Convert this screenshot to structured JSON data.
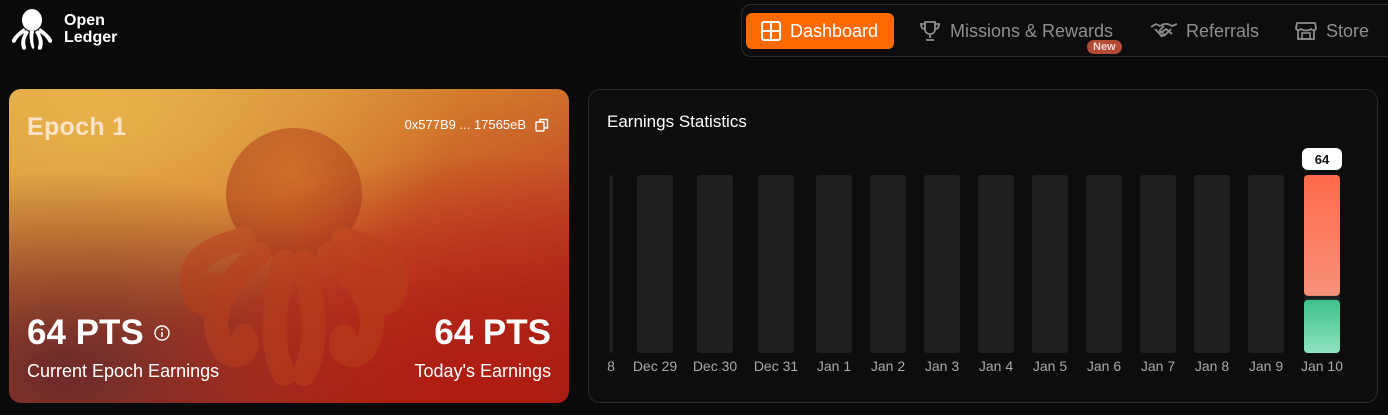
{
  "brand": {
    "line1": "Open",
    "line2": "Ledger"
  },
  "nav": {
    "items": [
      {
        "label": "Dashboard",
        "icon": "grid-icon",
        "active": true
      },
      {
        "label": "Missions & Rewards",
        "icon": "trophy-icon",
        "active": false,
        "badge": "New"
      },
      {
        "label": "Referrals",
        "icon": "handshake-icon",
        "active": false
      },
      {
        "label": "Store",
        "icon": "store-icon",
        "active": false
      }
    ],
    "accent": "#ff6a00"
  },
  "epoch": {
    "title": "Epoch 1",
    "wallet": "0x577B9 ... 17565eB",
    "current_value": "64 PTS",
    "current_label": "Current Epoch Earnings",
    "today_value": "64 PTS",
    "today_label": "Today's Earnings"
  },
  "stats": {
    "title": "Earnings Statistics"
  },
  "chart_data": {
    "type": "bar",
    "title": "Earnings Statistics",
    "categories": [
      "8",
      "Dec 29",
      "Dec 30",
      "Dec 31",
      "Jan 1",
      "Jan 2",
      "Jan 3",
      "Jan 4",
      "Jan 5",
      "Jan 6",
      "Jan 7",
      "Jan 8",
      "Jan 9",
      "Jan 10"
    ],
    "values": [
      0,
      0,
      0,
      0,
      0,
      0,
      0,
      0,
      0,
      0,
      0,
      0,
      0,
      64
    ],
    "data_labels": [
      null,
      null,
      null,
      null,
      null,
      null,
      null,
      null,
      null,
      null,
      null,
      null,
      null,
      "64"
    ],
    "colors": {
      "track": "#1f1f21",
      "bar_top": "#ff6a4a",
      "bar_bottom": "#3dc28a"
    },
    "grid": false
  }
}
